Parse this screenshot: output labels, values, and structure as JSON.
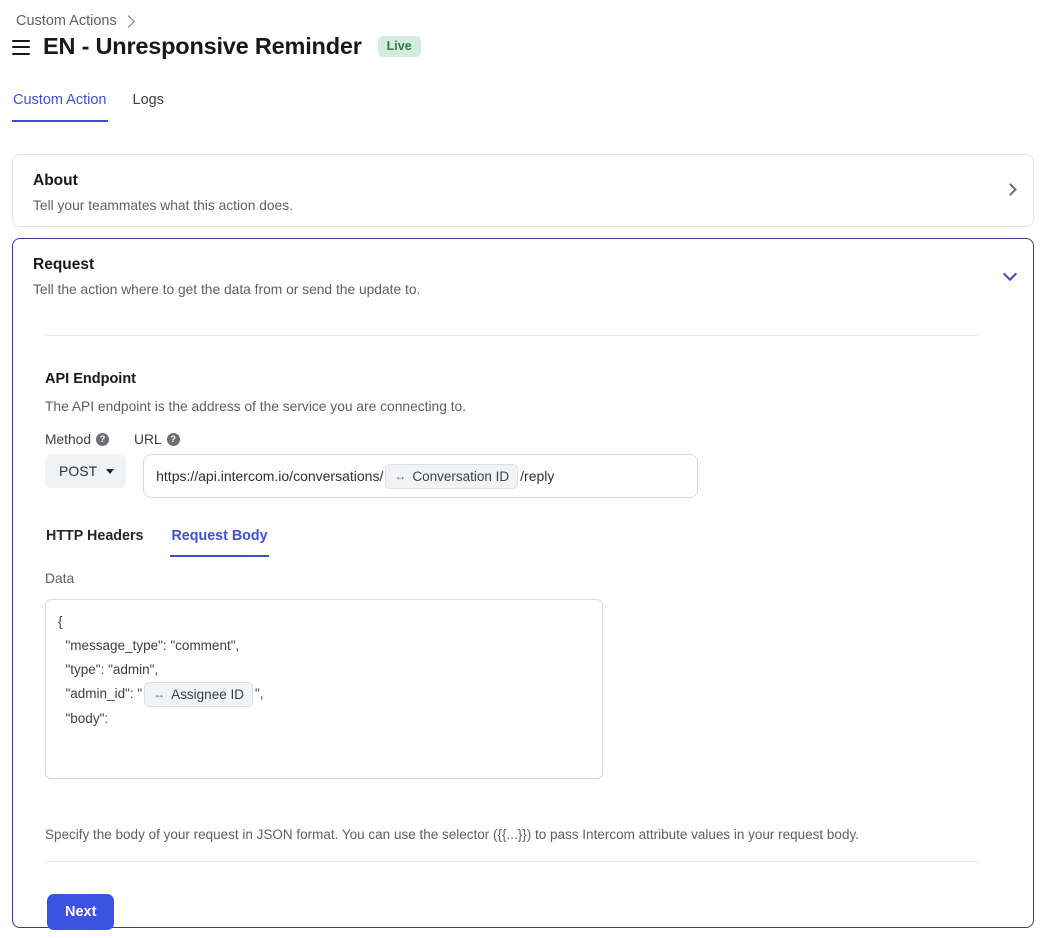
{
  "breadcrumb": {
    "parent": "Custom Actions",
    "chevron_icon": "chevron-right-icon"
  },
  "header": {
    "menu_icon": "hamburger-menu-icon",
    "title": "EN - Unresponsive Reminder",
    "status_badge": "Live",
    "badge_bg_color": "#d4edda",
    "badge_text_color": "#2f7d4f"
  },
  "tabs": [
    {
      "label": "Custom Action",
      "active": true
    },
    {
      "label": "Logs",
      "active": false
    }
  ],
  "about_card": {
    "title": "About",
    "subtitle": "Tell your teammates what this action does.",
    "expand_icon": "chevron-right-icon"
  },
  "request_card": {
    "title": "Request",
    "subtitle": "Tell the action where to get the data from or send the update to.",
    "collapse_icon": "chevron-down-icon",
    "border_color": "#323e8f",
    "api_endpoint": {
      "title": "API Endpoint",
      "subtitle": "The API endpoint is the address of the service you are connecting to.",
      "method_label": "Method",
      "method_help_icon": "help-circle-icon",
      "url_label": "URL",
      "url_help_icon": "help-circle-icon",
      "method_value": "POST",
      "method_caret_icon": "caret-down-icon",
      "url_prefix": "https://api.intercom.io/conversations/",
      "url_chip": {
        "icon": "attribute-double-arrow-icon",
        "glyph": "↔",
        "label": "Conversation ID"
      },
      "url_suffix": "/reply"
    },
    "subtabs": [
      {
        "label": "HTTP Headers",
        "active": false
      },
      {
        "label": "Request Body",
        "active": true
      }
    ],
    "data_label": "Data",
    "code": {
      "line1": "{",
      "line2": "  \"message_type\": \"comment\",",
      "line3": "  \"type\": \"admin\",",
      "line4_prefix": "  \"admin_id\": \"",
      "line4_chip": {
        "icon": "attribute-double-arrow-icon",
        "glyph": "↔",
        "label": "Assignee ID"
      },
      "line4_suffix": "\",",
      "line5_prefix": "  \"body\":",
      "line_last": "}",
      "redactions": 3,
      "redaction_color": "#000000"
    },
    "helper_text": "Specify the body of your request in JSON format. You can use the selector ({{...}}) to pass Intercom attribute values in your request body.",
    "next_button": {
      "label": "Next",
      "color": "#3b52e2"
    }
  }
}
